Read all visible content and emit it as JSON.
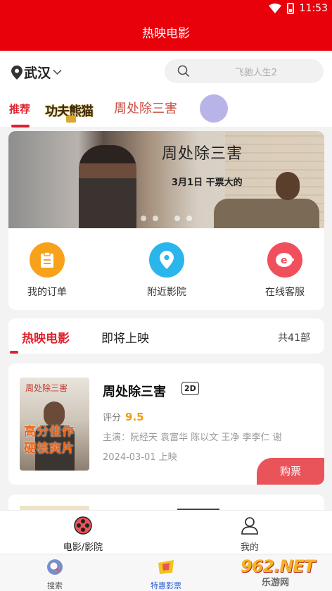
{
  "status_bar": {
    "time": "11:53"
  },
  "app_bar": {
    "title": "热映电影"
  },
  "top_bar": {
    "city": "武汉",
    "search_placeholder": "飞驰人生2"
  },
  "category_tabs": {
    "active": "推荐",
    "logos": [
      {
        "name": "功夫熊猫4",
        "image_text": "功夫熊猫"
      },
      {
        "name": "周处除三害",
        "image_text": "周处除三害"
      },
      {
        "name": "circle-logo"
      }
    ]
  },
  "banner": {
    "title": "周处除三害",
    "subtitle": "3月1日 干票大的",
    "slide_count": 4,
    "active_slide": 0
  },
  "quick_actions": [
    {
      "label": "我的订单",
      "icon": "clipboard-icon",
      "color": "#f8a21b"
    },
    {
      "label": "附近影院",
      "icon": "location-pin-icon",
      "color": "#2ab5ec"
    },
    {
      "label": "在线客服",
      "icon": "chat-e-icon",
      "color": "#f0505b"
    }
  ],
  "movie_tabs": {
    "tab1": "热映电影",
    "tab2": "即将上映",
    "count": "共41部"
  },
  "movies": [
    {
      "title": "周处除三害",
      "format": "2D",
      "score_label": "评分",
      "score": "9.5",
      "cast": "主演：阮经天 袁富华 陈以文 王净 李李仁 谢",
      "date": "2024-03-01 上映",
      "buy_label": "购票",
      "poster_text": "周处除三害",
      "poster_slogan_1": "高分佳作",
      "poster_slogan_2": "硬核爽片"
    }
  ],
  "sub_nav": [
    {
      "label": "电影/影院",
      "icon": "film-reel-icon",
      "active": true
    },
    {
      "label": "我的",
      "icon": "user-icon",
      "active": false
    }
  ],
  "bottom_nav": [
    {
      "label": "搜索",
      "icon": "search-icon"
    },
    {
      "label": "特惠影票",
      "icon": "ticket-icon"
    }
  ],
  "watermark": {
    "logo": "962.NET",
    "text": "乐游网"
  },
  "colors": {
    "brand_red": "#e8000b",
    "accent_red": "#e0202e",
    "score_orange": "#f29b12",
    "buy_red": "#e9545a"
  }
}
